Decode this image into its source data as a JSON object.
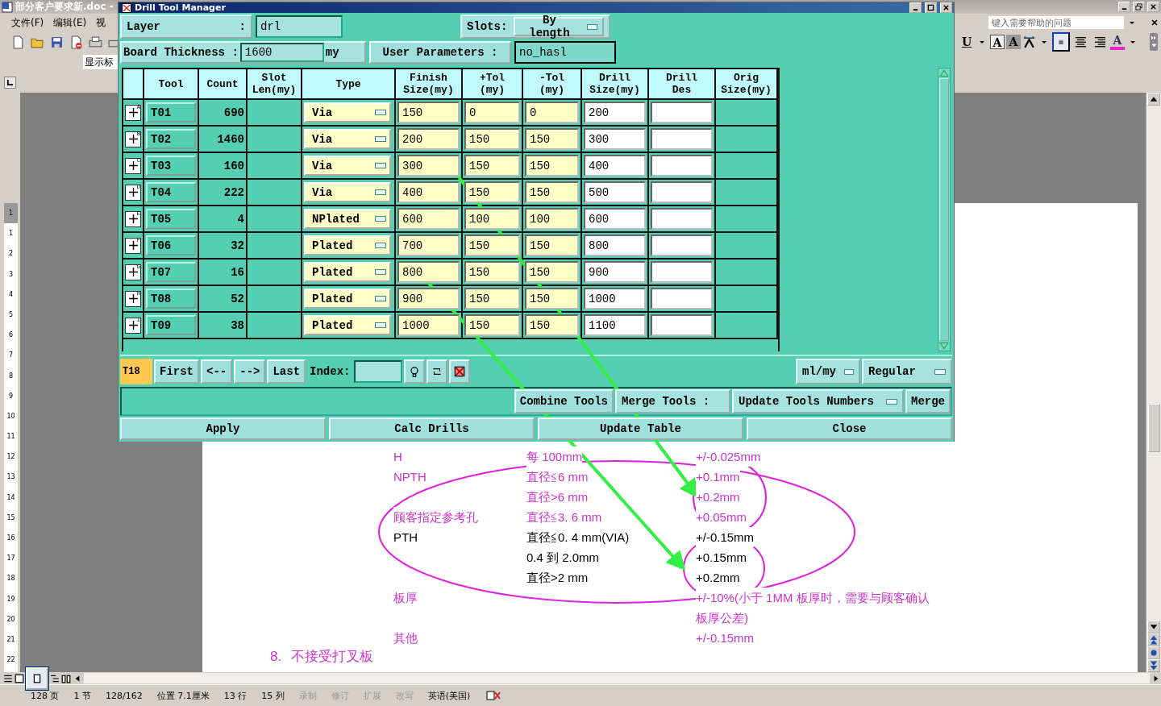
{
  "word": {
    "title": "部分客户要求新.doc -",
    "menus": [
      "文件(F)",
      "编辑(E)",
      "视"
    ],
    "style_box": "显示标",
    "help_placeholder": "键入需要帮助的问题",
    "format_buttons": [
      {
        "kind": "underline",
        "glyph": "U"
      },
      {
        "kind": "boxed",
        "glyph": "A"
      },
      {
        "kind": "shaded",
        "glyph": "A"
      },
      {
        "kind": "spacing"
      },
      {
        "kind": "justify",
        "selected": true
      },
      {
        "kind": "center",
        "selected": false
      },
      {
        "kind": "right",
        "selected": false
      },
      {
        "kind": "fontcolor",
        "glyph": "A"
      }
    ],
    "ruler_marks": [
      "1",
      "1",
      "2",
      "3",
      "4",
      "5",
      "6",
      "7",
      "8",
      "9",
      "10",
      "11",
      "12",
      "13",
      "14",
      "15",
      "16",
      "17",
      "18",
      "19",
      "20",
      "21",
      "22"
    ],
    "doc_rows": [
      {
        "label": "H",
        "spec": "每 100mm",
        "tolerance": "+/-0.025mm",
        "color": "#cc33cc"
      },
      {
        "label": "NPTH",
        "spec": "直径≦6 mm",
        "tolerance": "+0.1mm",
        "color": "#cc33cc"
      },
      {
        "spec": "直径>6 mm",
        "tolerance": "+0.2mm",
        "color": "#cc33cc"
      },
      {
        "label": "顾客指定参考孔",
        "spec": "直径≦3. 6 mm",
        "tolerance": "+0.05mm",
        "color": "#cc33cc"
      },
      {
        "label": "PTH",
        "spec": "直径≦0. 4 mm(VIA)",
        "tolerance": "+/-0.15mm",
        "color": "#000000"
      },
      {
        "spec": "0.4 到 2.0mm",
        "tolerance": "+0.15mm",
        "color": "#000000"
      },
      {
        "spec": "直径>2 mm",
        "tolerance": "+0.2mm",
        "color": "#000000"
      },
      {
        "label": "板厚",
        "tolerance": "+/-10%(小于 1MM 板厚时，需要与顾客确认板厚公差)",
        "color": "#cc33cc"
      },
      {
        "label": "其他",
        "tolerance": "+/-0.15mm",
        "color": "#cc33cc"
      }
    ],
    "doc_heading": {
      "number": "8.",
      "text": "不接受打叉板"
    },
    "status_items": [
      {
        "text": "128 页",
        "disabled": false
      },
      {
        "text": "1 节",
        "disabled": false
      },
      {
        "text": "128/162",
        "disabled": false
      },
      {
        "text": "位置 7.1厘米",
        "disabled": false
      },
      {
        "text": "13 行",
        "disabled": false
      },
      {
        "text": "15 列",
        "disabled": false
      },
      {
        "text": "录制",
        "disabled": true
      },
      {
        "text": "修订",
        "disabled": true
      },
      {
        "text": "扩展",
        "disabled": true
      },
      {
        "text": "改写",
        "disabled": true
      },
      {
        "text": "英语(美国)",
        "disabled": false
      }
    ]
  },
  "dialog": {
    "title": "Drill Tool Manager",
    "layer_label": "Layer",
    "layer_colon": ":",
    "layer_value": "drl",
    "slots_label": "Slots:",
    "slots_value": "By length",
    "thickness_label": "Board Thickness :",
    "thickness_value": "1600",
    "thickness_unit": "my",
    "user_params_button": "User Parameters :",
    "user_params_value": "no_hasl",
    "columns": [
      "Tool",
      "Count",
      "Slot\nLen(my)",
      "Type",
      "Finish\nSize(my)",
      "+Tol\n(my)",
      "-Tol\n(my)",
      "Drill\nSize(my)",
      "Drill\nDes",
      "Orig\nSize(my)"
    ],
    "rows": [
      {
        "mark": "A",
        "tool": "T01",
        "count": "690",
        "type": "Via",
        "finish": "150",
        "plus_tol": "0",
        "minus_tol": "0",
        "drill_size": "200"
      },
      {
        "mark": "B",
        "tool": "T02",
        "count": "1460",
        "type": "Via",
        "finish": "200",
        "plus_tol": "150",
        "minus_tol": "150",
        "drill_size": "300"
      },
      {
        "mark": "C",
        "tool": "T03",
        "count": "160",
        "type": "Via",
        "finish": "300",
        "plus_tol": "150",
        "minus_tol": "150",
        "drill_size": "400"
      },
      {
        "mark": "D",
        "tool": "T04",
        "count": "222",
        "type": "Via",
        "finish": "400",
        "plus_tol": "150",
        "minus_tol": "150",
        "drill_size": "500"
      },
      {
        "mark": "E",
        "tool": "T05",
        "count": "4",
        "type": "NPlated",
        "finish": "600",
        "plus_tol": "100",
        "minus_tol": "100",
        "drill_size": "600"
      },
      {
        "mark": "F",
        "tool": "T06",
        "count": "32",
        "type": "Plated",
        "finish": "700",
        "plus_tol": "150",
        "minus_tol": "150",
        "drill_size": "800"
      },
      {
        "mark": "G",
        "tool": "T07",
        "count": "16",
        "type": "Plated",
        "finish": "800",
        "plus_tol": "150",
        "minus_tol": "150",
        "drill_size": "900"
      },
      {
        "mark": "H",
        "tool": "T08",
        "count": "52",
        "type": "Plated",
        "finish": "900",
        "plus_tol": "150",
        "minus_tol": "150",
        "drill_size": "1000"
      },
      {
        "mark": "I",
        "tool": "T09",
        "count": "38",
        "type": "Plated",
        "finish": "1000",
        "plus_tol": "150",
        "minus_tol": "150",
        "drill_size": "1100"
      }
    ],
    "current_tool": "T18",
    "nav_buttons": [
      "First",
      "<--",
      "-->",
      "Last"
    ],
    "index_label": "Index:",
    "unit_select": "ml/my",
    "mode_select": "Regular",
    "combine_button": "Combine Tools",
    "merge_label": "Merge Tools :",
    "merge_select": "Update Tools Numbers",
    "merge_button": "Merge",
    "actions": [
      "Apply",
      "Calc Drills",
      "Update Table",
      "Close"
    ]
  }
}
